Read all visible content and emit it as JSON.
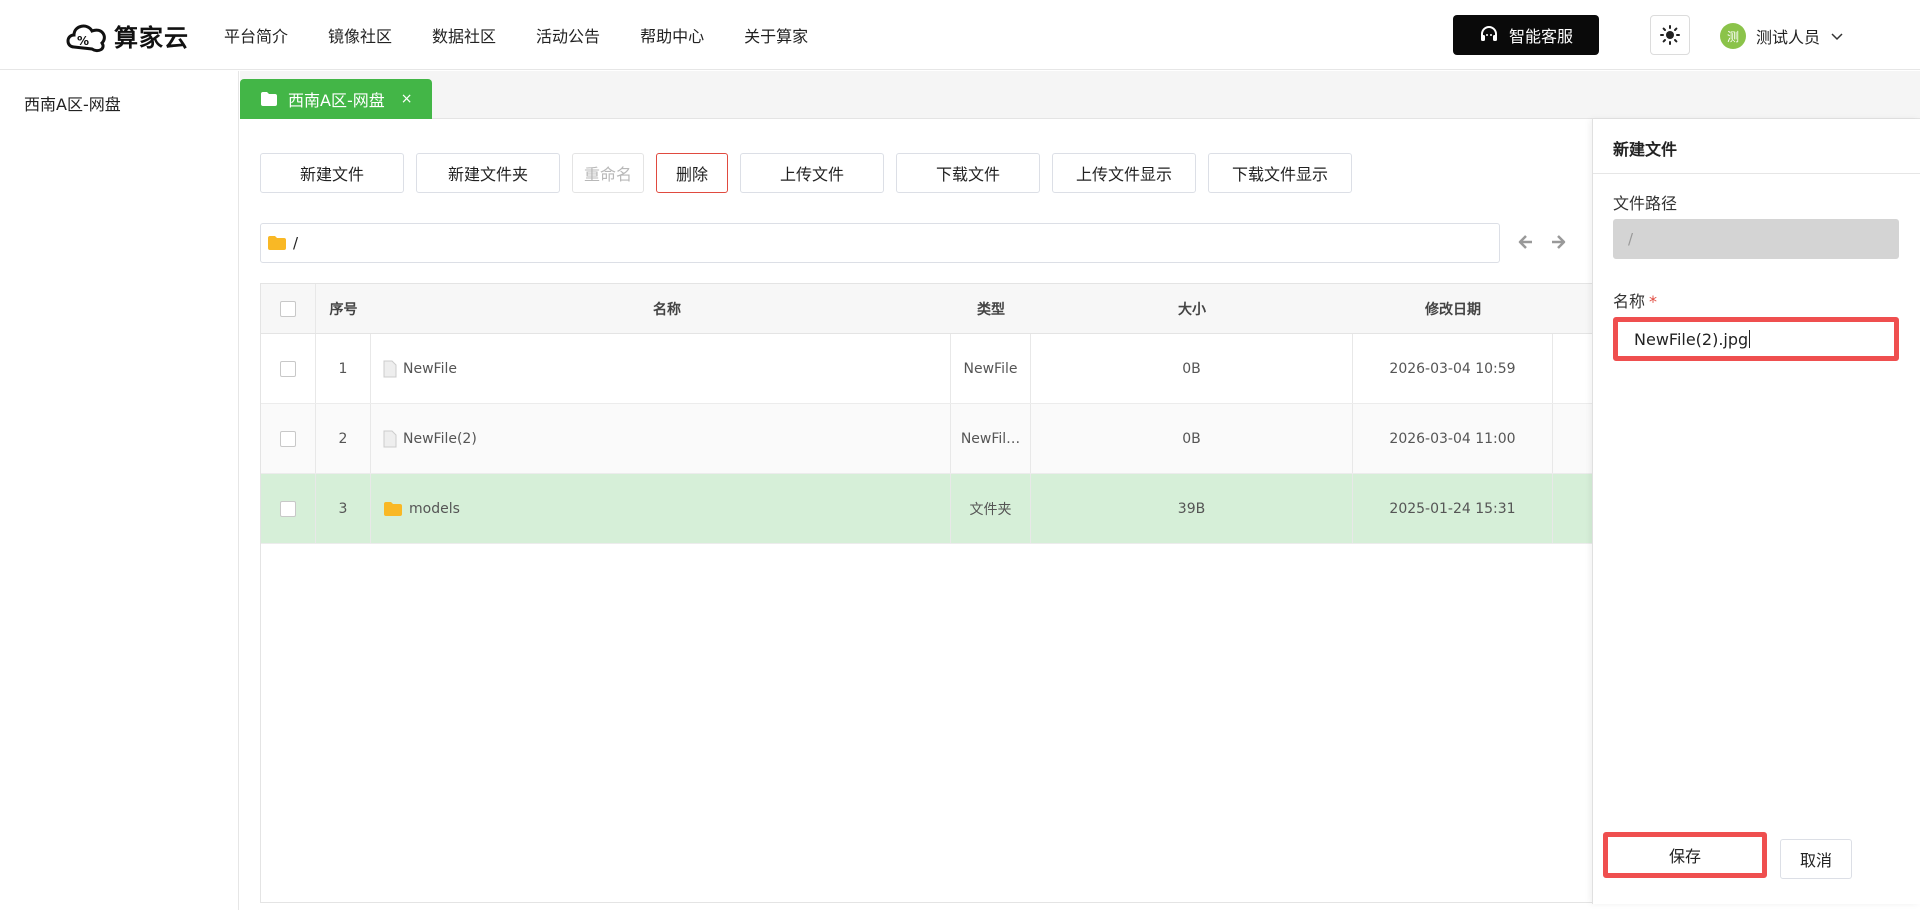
{
  "header": {
    "logo_text": "算家云",
    "nav": [
      "平台简介",
      "镜像社区",
      "数据社区",
      "活动公告",
      "帮助中心",
      "关于算家"
    ],
    "service_label": "智能客服",
    "user_avatar": "测",
    "user_name": "测试人员"
  },
  "sidebar": {
    "items": [
      {
        "label": "西南A区-网盘"
      }
    ]
  },
  "tab": {
    "label": "西南A区-网盘",
    "close": "×"
  },
  "toolbar": {
    "new_file": "新建文件",
    "new_folder": "新建文件夹",
    "rename": "重命名",
    "delete": "删除",
    "upload": "上传文件",
    "download": "下载文件",
    "upload_display": "上传文件显示",
    "download_display": "下载文件显示"
  },
  "path": "/",
  "table": {
    "headers": {
      "no": "序号",
      "name": "名称",
      "type": "类型",
      "size": "大小",
      "date": "修改日期"
    },
    "rows": [
      {
        "no": "1",
        "name": "NewFile",
        "type": "NewFile",
        "size": "0B",
        "date": "2026-03-04 10:59",
        "icon": "file-icon"
      },
      {
        "no": "2",
        "name": "NewFile(2)",
        "type": "NewFil…",
        "size": "0B",
        "date": "2026-03-04 11:00",
        "icon": "file-icon"
      },
      {
        "no": "3",
        "name": "models",
        "type": "文件夹",
        "size": "39B",
        "date": "2025-01-24 15:31",
        "icon": "folder-icon"
      }
    ]
  },
  "panel": {
    "title": "新建文件",
    "path_label": "文件路径",
    "path_value": "/",
    "name_label": "名称",
    "required_mark": "*",
    "name_value": "NewFile(2).jpg",
    "save_label": "保存",
    "cancel_label": "取消"
  },
  "colors": {
    "accent": "#43b647",
    "danger": "#e04a3f",
    "highlight": "#ef4f4f",
    "selected_row": "#d6efd8",
    "folder": "#f9b825"
  }
}
